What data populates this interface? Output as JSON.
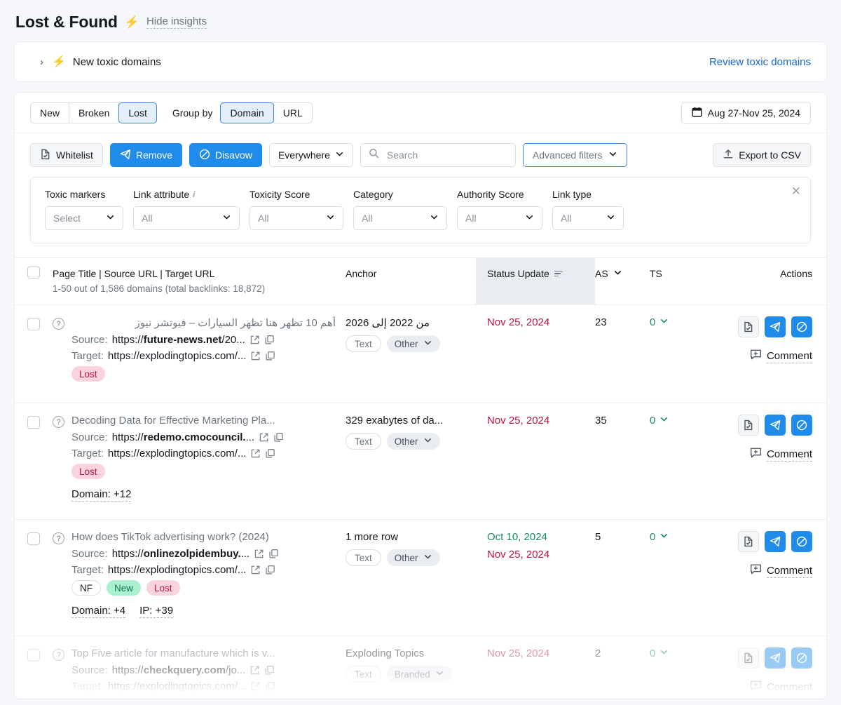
{
  "header": {
    "title": "Lost & Found",
    "bolt_icon": "bolt-icon",
    "hide_insights": "Hide insights"
  },
  "insight": {
    "chevron": "›",
    "label": "New toxic domains",
    "review_link": "Review toxic domains"
  },
  "tabs": {
    "items": [
      {
        "label": "New",
        "active": false
      },
      {
        "label": "Broken",
        "active": false
      },
      {
        "label": "Lost",
        "active": true
      }
    ],
    "group_by_label": "Group by",
    "group_by": [
      {
        "label": "Domain",
        "active": true
      },
      {
        "label": "URL",
        "active": false
      }
    ],
    "date_range": "Aug 27-Nov 25, 2024"
  },
  "toolbar": {
    "whitelist": "Whitelist",
    "remove": "Remove",
    "disavow": "Disavow",
    "scope": "Everywhere",
    "search_placeholder": "Search",
    "search_value": "",
    "advanced_filters": "Advanced filters",
    "export": "Export to CSV"
  },
  "filters": {
    "close": "✕",
    "groups": [
      {
        "label": "Toxic markers",
        "value": "Select",
        "info": false
      },
      {
        "label": "Link attribute",
        "value": "All",
        "info": true
      },
      {
        "label": "Toxicity Score",
        "value": "All",
        "info": false
      },
      {
        "label": "Category",
        "value": "All",
        "info": false
      },
      {
        "label": "Authority Score",
        "value": "All",
        "info": false
      },
      {
        "label": "Link type",
        "value": "All",
        "info": false
      }
    ]
  },
  "table": {
    "columns": {
      "title": "Page Title | Source URL | Target URL",
      "subtitle": "1-50 out of 1,586 domains (total backlinks: 18,872)",
      "anchor": "Anchor",
      "status": "Status Update",
      "as": "AS",
      "ts": "TS",
      "actions": "Actions"
    },
    "source_label": "Source:",
    "target_label": "Target:",
    "comment_label": "Comment",
    "rows": [
      {
        "page_title": "أهم 10 تظهر هنا تظهر السيارات – فيوتشر نيوز",
        "rtl_title": true,
        "source_prefix": "https://",
        "source_domain": "future-news.net",
        "source_suffix": "/20...",
        "target_prefix": "https://",
        "target_domain": "explodingtopics.com",
        "target_suffix": "/...",
        "badges": [
          {
            "text": "Lost",
            "style": "lost"
          }
        ],
        "sub_links": [],
        "anchor": "من 2022 إلى 2026",
        "anchor_rtl": true,
        "anchor_tags": [
          {
            "text": "Text",
            "style": "outline"
          },
          {
            "text": "Other",
            "style": "solid"
          }
        ],
        "status_dates": [
          {
            "date": "Nov 25, 2024",
            "color": "red"
          }
        ],
        "as": "23",
        "ts": "0"
      },
      {
        "page_title": "Decoding Data for Effective Marketing Pla...",
        "rtl_title": false,
        "source_prefix": "https://",
        "source_domain": "redemo.cmocouncil.",
        "source_suffix": "...",
        "target_prefix": "https://",
        "target_domain": "explodingtopics.com",
        "target_suffix": "/...",
        "badges": [
          {
            "text": "Lost",
            "style": "lost"
          }
        ],
        "sub_links": [
          "Domain: +12"
        ],
        "anchor": "329 exabytes of da...",
        "anchor_rtl": false,
        "anchor_tags": [
          {
            "text": "Text",
            "style": "outline"
          },
          {
            "text": "Other",
            "style": "solid"
          }
        ],
        "status_dates": [
          {
            "date": "Nov 25, 2024",
            "color": "red"
          }
        ],
        "as": "35",
        "ts": "0"
      },
      {
        "page_title": "How does TikTok advertising work? (2024)",
        "rtl_title": false,
        "source_prefix": "https://",
        "source_domain": "onlinezolpidembuy.",
        "source_suffix": "...",
        "target_prefix": "https://",
        "target_domain": "explodingtopics.com",
        "target_suffix": "/...",
        "badges": [
          {
            "text": "NF",
            "style": "nf"
          },
          {
            "text": "New",
            "style": "new"
          },
          {
            "text": "Lost",
            "style": "lost"
          }
        ],
        "sub_links": [
          "Domain: +4",
          "IP: +39"
        ],
        "anchor": "1 more row",
        "anchor_rtl": false,
        "anchor_tags": [
          {
            "text": "Text",
            "style": "outline"
          },
          {
            "text": "Other",
            "style": "solid"
          }
        ],
        "status_dates": [
          {
            "date": "Oct 10, 2024",
            "color": "green"
          },
          {
            "date": "Nov 25, 2024",
            "color": "red"
          }
        ],
        "as": "5",
        "ts": "0"
      },
      {
        "page_title": "Top Five article for manufacture which is v...",
        "rtl_title": false,
        "source_prefix": "https://",
        "source_domain": "checkquery.com",
        "source_suffix": "/jo...",
        "target_prefix": "https://",
        "target_domain": "explodingtopics.com",
        "target_suffix": "/...",
        "badges": [],
        "sub_links": [],
        "anchor": "Exploding Topics",
        "anchor_rtl": false,
        "anchor_tags": [
          {
            "text": "Text",
            "style": "outline"
          },
          {
            "text": "Branded",
            "style": "solid"
          }
        ],
        "status_dates": [
          {
            "date": "Nov 25, 2024",
            "color": "red"
          }
        ],
        "as": "2",
        "ts": "0"
      }
    ]
  },
  "colors": {
    "accent_blue": "#1f8ceb",
    "link_blue": "#1667cf",
    "danger_red": "#c0133f",
    "success_green": "#168f62",
    "bolt_red": "#ee0033",
    "lost_badge_bg": "#fbd3dc",
    "new_badge_bg": "#a9efd0"
  }
}
